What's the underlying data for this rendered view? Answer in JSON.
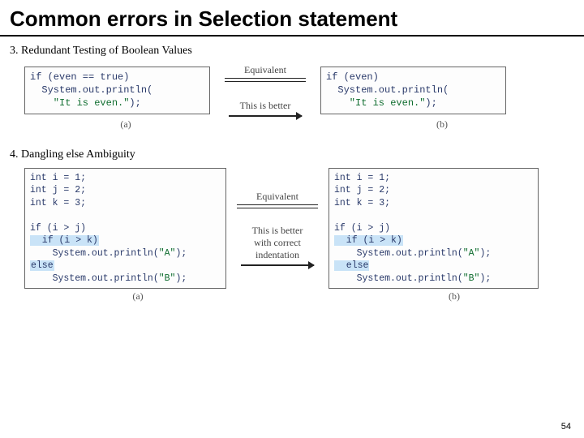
{
  "title": "Common errors in Selection statement",
  "section3": {
    "heading": "3. Redundant Testing of Boolean Values",
    "codeA_l1": "if (even == true)",
    "codeA_l2": "  System.out.println(",
    "codeA_l3_str": "    \"It is even.\"",
    "codeA_l3_tail": ");",
    "mid_top": "Equivalent",
    "mid_bottom": "This is better",
    "codeB_l1": "if (even)",
    "codeB_l2": "  System.out.println(",
    "codeB_l3_str": "    \"It is even.\"",
    "codeB_l3_tail": ");",
    "cap_a": "(a)",
    "cap_b": "(b)"
  },
  "section4": {
    "heading": "4. Dangling else Ambiguity",
    "codeA_l1": "int i = 1;",
    "codeA_l2": "int j = 2;",
    "codeA_l3": "int k = 3;",
    "codeA_l4": "",
    "codeA_l5": "if (i > j)",
    "codeA_l6": "  if (i > k)",
    "codeA_l7a": "    System.out.println(",
    "codeA_l7s": "\"A\"",
    "codeA_l7b": ");",
    "codeA_l8": "else",
    "codeA_l9a": "    System.out.println(",
    "codeA_l9s": "\"B\"",
    "codeA_l9b": ");",
    "mid_top": "Equivalent",
    "mid_mid1": "This is better",
    "mid_mid2": "with correct",
    "mid_mid3": "indentation",
    "codeB_l1": "int i = 1;",
    "codeB_l2": "int j = 2;",
    "codeB_l3": "int k = 3;",
    "codeB_l4": "",
    "codeB_l5": "if (i > j)",
    "codeB_l6": "  if (i > k)",
    "codeB_l7a": "    System.out.println(",
    "codeB_l7s": "\"A\"",
    "codeB_l7b": ");",
    "codeB_l8": "  else",
    "codeB_l9a": "    System.out.println(",
    "codeB_l9s": "\"B\"",
    "codeB_l9b": ");",
    "cap_a": "(a)",
    "cap_b": "(b)"
  },
  "page_number": "54"
}
